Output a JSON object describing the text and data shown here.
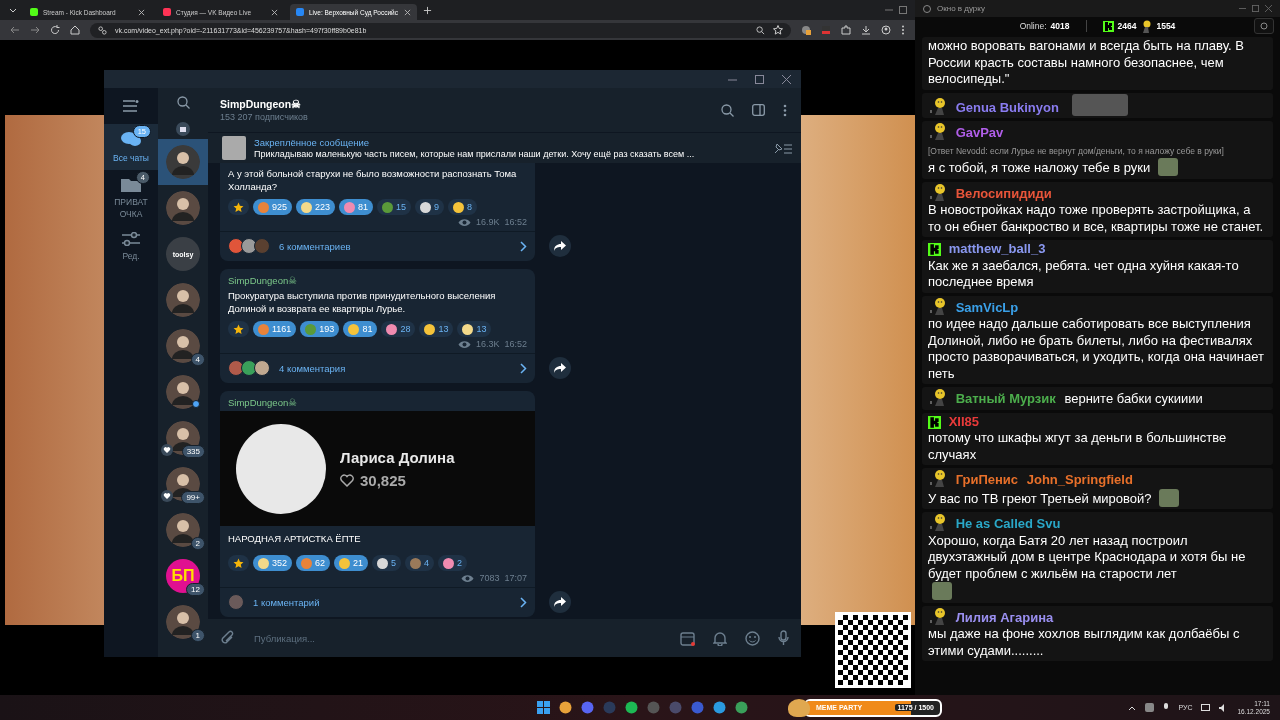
{
  "browser": {
    "tabs": [
      {
        "label": "Stream - Kick Dashboard",
        "selected": false,
        "color": "#53fc18"
      },
      {
        "label": "Студия — VK Видео Live",
        "selected": false,
        "color": "#ff3355"
      },
      {
        "label": "Live: Верховный Суд Российс",
        "selected": true,
        "color": "#2787f5"
      }
    ],
    "url": "vk.com/video_ext.php?oid=-211631773&id=456239757&hash=497f30ff89b0e81b"
  },
  "telegram": {
    "channel_name": "SimpDungeon☠",
    "subscribers": "153 207 подписчиков",
    "folders": [
      {
        "label": "Все чаты",
        "badge": "15",
        "selected": true
      },
      {
        "label": "ПРИВАТ ОЧКА",
        "badge": "4",
        "selected": false
      },
      {
        "label": "Ред.",
        "selected": false
      }
    ],
    "chats": [
      {
        "selected": false,
        "heart": false,
        "online": false,
        "kind": "archive"
      },
      {
        "selected": true,
        "heart": false,
        "online": false,
        "kind": "photo"
      },
      {
        "selected": false,
        "heart": false,
        "online": false,
        "kind": "photo"
      },
      {
        "selected": false,
        "label": "toolsy",
        "heart": false,
        "online": false,
        "kind": "logo"
      },
      {
        "selected": false,
        "heart": false,
        "online": false,
        "kind": "photo"
      },
      {
        "selected": false,
        "badge": "4",
        "heart": false,
        "online": false,
        "kind": "photo"
      },
      {
        "selected": false,
        "heart": false,
        "online": true,
        "kind": "photo"
      },
      {
        "selected": false,
        "badge": "335",
        "heart": true,
        "online": false,
        "kind": "photo"
      },
      {
        "selected": false,
        "badge": "99+",
        "heart": true,
        "online": false,
        "kind": "photo"
      },
      {
        "selected": false,
        "badge": "2",
        "heart": false,
        "online": false,
        "kind": "photo"
      },
      {
        "selected": false,
        "label": "БП",
        "badge": "12",
        "heart": false,
        "online": false,
        "kind": "logo"
      },
      {
        "selected": false,
        "badge": "1",
        "heart": false,
        "online": false,
        "kind": "photo"
      }
    ],
    "pinned": {
      "title": "Закреплённое сообщение",
      "text": "Прикладываю маленькую часть писем, которые нам прислали наши детки.   Хочу ещё раз сказать всем ..."
    },
    "posts": [
      {
        "text": "А у этой больной старухи не было возможности распознать Тома Холланда?",
        "reactions": [
          {
            "kind": "star",
            "selected": false,
            "color": "#f5b50a"
          },
          {
            "kind": "emoji",
            "count": "925",
            "selected": true,
            "color": "#e8833a"
          },
          {
            "kind": "emoji",
            "count": "223",
            "selected": true,
            "color": "#f3d98a"
          },
          {
            "kind": "emoji",
            "count": "81",
            "selected": true,
            "color": "#f08bb0"
          },
          {
            "kind": "emoji",
            "count": "15",
            "selected": false,
            "color": "#5a9a3a"
          },
          {
            "kind": "emoji",
            "count": "9",
            "selected": false,
            "color": "#d8d8d8"
          },
          {
            "kind": "emoji",
            "count": "8",
            "selected": false,
            "color": "#f5c33a"
          }
        ],
        "views": "16.9K",
        "time": "16:52",
        "comments": "6 комментариев",
        "commenters": [
          {
            "color": "#e0553a"
          },
          {
            "color": "#9a9a9a"
          },
          {
            "color": "#5a4030"
          }
        ]
      },
      {
        "author": "SimpDungeon☠",
        "text": "Прокуратура выступила против принудительного выселения Долиной и возврата ее квартиры Лурье.",
        "reactions": [
          {
            "kind": "star",
            "selected": false,
            "color": "#f5b50a"
          },
          {
            "kind": "emoji",
            "count": "1161",
            "selected": true,
            "color": "#e8833a"
          },
          {
            "kind": "emoji",
            "count": "193",
            "selected": true,
            "color": "#5a9a3a"
          },
          {
            "kind": "emoji",
            "count": "81",
            "selected": true,
            "color": "#f5c33a"
          },
          {
            "kind": "emoji",
            "count": "28",
            "selected": false,
            "color": "#f08bb0"
          },
          {
            "kind": "emoji",
            "count": "13",
            "selected": false,
            "color": "#f5c33a"
          },
          {
            "kind": "emoji",
            "count": "13",
            "selected": false,
            "color": "#f3d98a"
          }
        ],
        "views": "16.3K",
        "time": "16:52",
        "comments": "4 комментария",
        "commenters": [
          {
            "color": "#b05a4a"
          },
          {
            "color": "#3aa05a"
          },
          {
            "color": "#c0a890"
          }
        ]
      },
      {
        "author": "SimpDungeon☠",
        "media": {
          "name": "Лариса Долина",
          "likes": "30,825"
        },
        "text": "НАРОДНАЯ АРТИСТКА ЁПТЕ",
        "reactions": [
          {
            "kind": "star",
            "selected": false,
            "color": "#f5b50a"
          },
          {
            "kind": "emoji",
            "count": "352",
            "selected": true,
            "color": "#f3d98a"
          },
          {
            "kind": "emoji",
            "count": "62",
            "selected": true,
            "color": "#e8833a"
          },
          {
            "kind": "emoji",
            "count": "21",
            "selected": true,
            "color": "#f5c33a"
          },
          {
            "kind": "emoji",
            "count": "5",
            "selected": false,
            "color": "#d8d8d8"
          },
          {
            "kind": "emoji",
            "count": "4",
            "selected": false,
            "color": "#9a7a5a"
          },
          {
            "kind": "emoji",
            "count": "2",
            "selected": false,
            "color": "#f08bb0"
          }
        ],
        "views": "7083",
        "time": "17:07",
        "comments": "1 комментарий",
        "commenters": [
          {
            "color": "#6a5a5a"
          }
        ]
      }
    ],
    "composer": {
      "placeholder": "Публикация..."
    }
  },
  "chat": {
    "window_title": "Окно в дурку",
    "online_label": "Online:",
    "online": "4018",
    "kick_count": "2464",
    "emote_count": "1554",
    "messages": [
      {
        "kind": "continuation",
        "text": "можно воровать вагонами и всегда быть на плаву. В России красть составы намного безопаснее, чем велосипеды.\"",
        "trailing_emote": false
      },
      {
        "kind": "emote",
        "name": "Genua Bukinyon",
        "color": "#8a7cf0",
        "trailing_emote": true
      },
      {
        "kind": "emote",
        "name": "GavPav",
        "color": "#b05ee8",
        "reply": "[Ответ Nevodd: если Лурье не вернут дом/деньги, то я наложу себе в руки]",
        "text": "я с тобой, я тоже наложу тебе в руки",
        "trailing_emote": true
      },
      {
        "kind": "emote",
        "name": "Велосипидиди",
        "color": "#e8553a",
        "text": "В новостройках надо тоже проверять застройщика, а то он ебнет банкроство и все, квартиры тоже не станет.",
        "trailing_emote": false
      },
      {
        "kind": "kick",
        "name": "matthew_ball_3",
        "color": "#8a98f0",
        "text": "Как же я заебался, ребята. чет одна хуйня какая-то последнее время",
        "trailing_emote": false
      },
      {
        "kind": "emote",
        "name": "SamVicLp",
        "color": "#3aa0e8",
        "text": "по идее надо дальше саботировать все выступления Долиной, либо не брать билеты, либо на фестивалях просто разворачиваться, и уходить, когда она начинает петь",
        "trailing_emote": false
      },
      {
        "kind": "emote",
        "name": "Ватный Мурзик",
        "color": "#4cae4c",
        "text": "верните бабки сукииии",
        "trailing_emote": false
      },
      {
        "kind": "kick",
        "name": "XII85",
        "color": "#e83a3a",
        "text": "потому что шкафы жгут за деньги в большинстве случаях",
        "trailing_emote": false
      },
      {
        "kind": "emote",
        "name": "ГриПенис",
        "color": "#e8702a",
        "mention": "John_Springfield",
        "text": "У вас по ТВ греют Третьей мировой?",
        "trailing_emote": true
      },
      {
        "kind": "emote",
        "name": "He as Called Svu",
        "color": "#2aa8c8",
        "text": "Хорошо, когда Батя 20 лет назад построил двухэтажный дом в центре Краснодара и хотя бы не будет проблем с жильём на старости лет",
        "trailing_emote": true
      },
      {
        "kind": "emote",
        "name": "Лилия Агарина",
        "color": "#9a8ff0",
        "text": "мы даже на фоне хохлов выглядим как долбаёбы с этими судами.........",
        "trailing_emote": false
      }
    ]
  },
  "taskbar": {
    "widget_title": "MEME PARTY",
    "widget_progress": "1175 / 1500",
    "level": 0.78,
    "language": "РУС",
    "time": "17:11",
    "date": "16.12.2025"
  }
}
